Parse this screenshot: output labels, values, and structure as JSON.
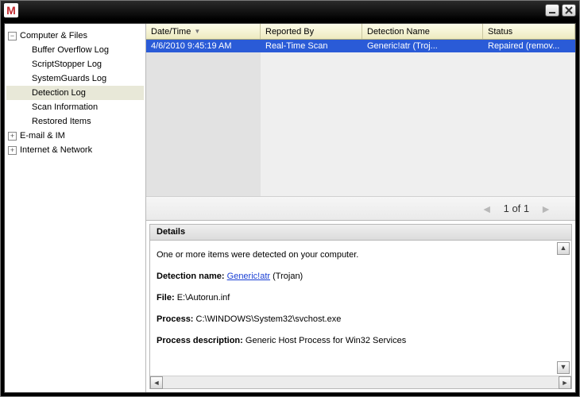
{
  "logo_letter": "M",
  "sidebar": {
    "groups": [
      {
        "label": "Computer & Files",
        "expanded": true,
        "toggle": "−",
        "children": [
          "Buffer Overflow Log",
          "ScriptStopper Log",
          "SystemGuards Log",
          "Detection Log",
          "Scan Information",
          "Restored Items"
        ],
        "selected_index": 3
      },
      {
        "label": "E-mail & IM",
        "expanded": false,
        "toggle": "+",
        "children": []
      },
      {
        "label": "Internet & Network",
        "expanded": false,
        "toggle": "+",
        "children": []
      }
    ]
  },
  "list": {
    "headers": {
      "datetime": "Date/Time",
      "reported_by": "Reported By",
      "detection_name": "Detection Name",
      "status": "Status"
    },
    "rows": [
      {
        "datetime": "4/6/2010 9:45:19 AM",
        "reported_by": "Real-Time Scan",
        "detection_name": "Generic!atr (Troj...",
        "status": "Repaired (remov..."
      }
    ],
    "paginator": "1 of 1"
  },
  "details": {
    "title": "Details",
    "intro": "One or more items were detected on your computer.",
    "detection_label": "Detection name:",
    "detection_link": "Generic!atr",
    "detection_type": "(Trojan)",
    "file_label": "File:",
    "file_value": "E:\\Autorun.inf",
    "process_label": "Process:",
    "process_value": "C:\\WINDOWS\\System32\\svchost.exe",
    "procdesc_label": "Process description:",
    "procdesc_value": "Generic Host Process for Win32 Services"
  }
}
